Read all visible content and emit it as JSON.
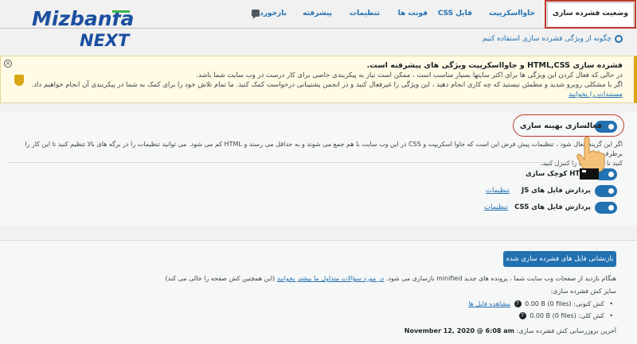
{
  "tabs": [
    {
      "label": "وضعیت فشرده سازی",
      "active": true
    },
    {
      "label": "جاوااسکریپت"
    },
    {
      "label": "فایل CSS"
    },
    {
      "label": "فونت ها"
    },
    {
      "label": "تنظیمات"
    },
    {
      "label": "پیشرفته"
    },
    {
      "label": "بازخورد"
    }
  ],
  "logo": {
    "line1": "Mizbanfa",
    "line2": "NEXT"
  },
  "howto_link": "چگونه از ویژگی فشرده سازی استفاده کنیم",
  "notice": {
    "title": "فشرده سازی HTML,CSS و جاوااسکریپت ویژگی های پیشرفته است.",
    "line1": "در حالی که فعال کردن این ویژگی ها برای اکثر سایتها بسیار مناسب است ، ممکن است نیاز به پیکربندی خاصی برای کار درست در وب سایت شما باشد.",
    "line2": "اگر با مشکلی روبرو شدید و مطمئن نیستید که چه کاری انجام دهید ، این ویژگی را غیرفعال کنید و در انجمن پشتیبانی درخواست کمک کنید. ما تمام تلاش خود را برای کمک به شما در پیکربندی آن انجام خواهیم داد.",
    "dismiss": "مستندات را بخوانید"
  },
  "optimization": {
    "main_label": "فعالسازی بهینه سازی",
    "description_line1": "اگر این گزینه فعال شود ، تنظیمات پیش فرض این است که جاوا اسکریپت و CSS در این وب سایت با هم جمع می شوند و به حداقل می رسند و HTML کم می شود. می توانید تنظیمات را در برگه های بالا تنظیم کنید تا این کار را برطرف",
    "description_line2": "کنید تا دقیقاً آنچه را کنترل کنید.",
    "rows": [
      {
        "label": "HTML کوچک سازی",
        "link": ""
      },
      {
        "label": "پردازش فایل های JS",
        "link": "تنظیمات"
      },
      {
        "label": "پردازش فایل های CSS",
        "link": "تنظیمات"
      }
    ]
  },
  "cache": {
    "button": "بازنشانی فایل های فشرده سازی شده",
    "info_text": "هنگام بازدید از صفحات وب سایت شما ، پرونده های جدید minified بازسازی می شود.",
    "info_link": "در مورد سؤالات متداول ما بیشتر بخوانید",
    "info_tail": "(این همچنین کش صفحه را خالی می کند)",
    "size_title": "سایز کش فشرده سازی:",
    "items": [
      {
        "label": "کش کنونی:",
        "value": "0.00 B (0 files)",
        "link": "مشاهده فایل ها"
      },
      {
        "label": "کش کلی:",
        "value": "0.00 B (0 files)",
        "link": ""
      }
    ],
    "last_update_label": "آخرین بروزرسانی کش فشرده سازی:",
    "last_update_value": "November 12, 2020 @ 6:08 am"
  },
  "colors": {
    "accent": "#2271b1",
    "highlight": "#c0392b",
    "notice_border": "#dba617"
  }
}
